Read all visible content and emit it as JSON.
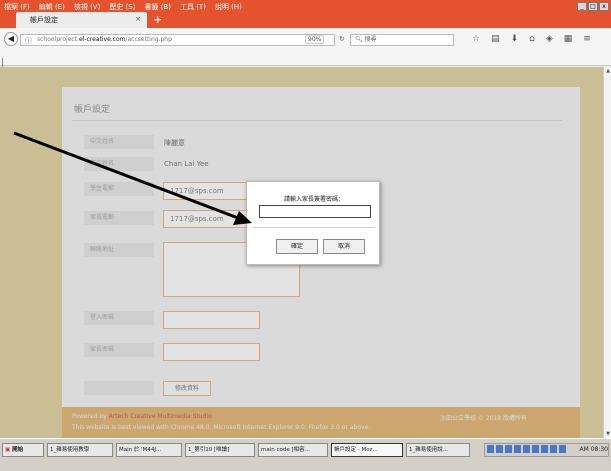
{
  "browser": {
    "menus": [
      "檔案 (F)",
      "編輯 (E)",
      "檢視 (V)",
      "歷史 (S)",
      "書籤 (B)",
      "工具 (T)",
      "說明 (H)"
    ],
    "window_buttons": [
      "_",
      "□",
      "x"
    ],
    "tab_title": "帳戶設定",
    "tab_close": "×",
    "new_tab": "+",
    "url_host_prefix": "schoolproject.",
    "url_host_bold": "el-creative.com",
    "url_path": "/accsetting.php",
    "zoom": "90%",
    "search_placeholder": "搜尋"
  },
  "page": {
    "heading": "帳戶設定",
    "fields": [
      {
        "label": "中文姓名",
        "value": "陳麗意"
      },
      {
        "label": "英文姓名",
        "value": "Chan Lai Yee"
      },
      {
        "label": "學生電郵",
        "value": "1717@sps.com"
      },
      {
        "label": "家長電郵",
        "value": "1717@sps.com"
      },
      {
        "label": "聯絡地址",
        "value": ""
      },
      {
        "label": "登入密碼",
        "value": ""
      },
      {
        "label": "家長密碼",
        "value": ""
      }
    ],
    "submit_label": "修改資料"
  },
  "footer": {
    "powered_by": "Powered by",
    "powered_name": "Artech Creative Multimedia Studio",
    "best_viewed": "This website is best viewed with Chrome 48.0, Microsoft Internet Explorer 9.0, Firefox 3.0 or above.",
    "copyright": "沙田公立學校 © 2018 版權所有"
  },
  "dialog": {
    "title": "請輸入家長簽署密碼：",
    "input_value": "",
    "ok_label": "確定",
    "cancel_label": "取消"
  },
  "taskbar": {
    "start_label": "開始",
    "tasks": [
      "1_雜易使用教學",
      "Main 於 'M44J...",
      "1_第引10 [唯讀]",
      "main code [相容...",
      "帳戶設定 - Moz...",
      "1_雜易使用說...",
      ""
    ],
    "clock": "AM 08:30"
  },
  "colors": {
    "accent": "#e4532d",
    "page_bg": "#d7c68e",
    "footer": "#d9a558",
    "input_border": "#e2a76f"
  }
}
